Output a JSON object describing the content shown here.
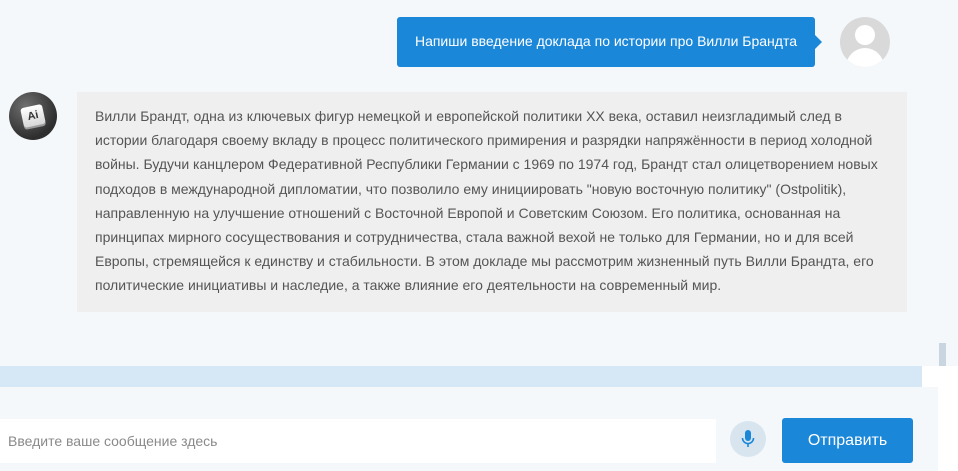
{
  "chat": {
    "user_message": "Напиши введение доклада по истории про Вилли Брандта",
    "ai_avatar_label": "Ai",
    "ai_message": "Вилли Брандт, одна из ключевых фигур немецкой и европейской политики XX века, оставил неизгладимый след в истории благодаря своему вкладу в процесс политического примирения и разрядки напряжённости в период холодной войны. Будучи канцлером Федеративной Республики Германии с 1969 по 1974 год, Брандт стал олицетворением новых подходов в международной дипломатии, что позволило ему инициировать \"новую восточную политику\" (Ostpolitik), направленную на улучшение отношений с Восточной Европой и Советским Союзом. Его политика, основанная на принципах мирного сосуществования и сотрудничества, стала важной вехой не только для Германии, но и для всей Европы, стремящейся к единству и стабильности. В этом докладе мы рассмотрим жизненный путь Вилли Брандта, его политические инициативы и наследие, а также влияние его деятельности на современный мир."
  },
  "composer": {
    "placeholder": "Введите ваше сообщение здесь",
    "value": "",
    "send_label": "Отправить",
    "mic_icon": "microphone-icon"
  },
  "colors": {
    "accent": "#1b87d8",
    "background": "#f4f8fb",
    "ai_bubble": "#efefef",
    "ai_text": "#555555",
    "divider": "#d6e8f6"
  }
}
